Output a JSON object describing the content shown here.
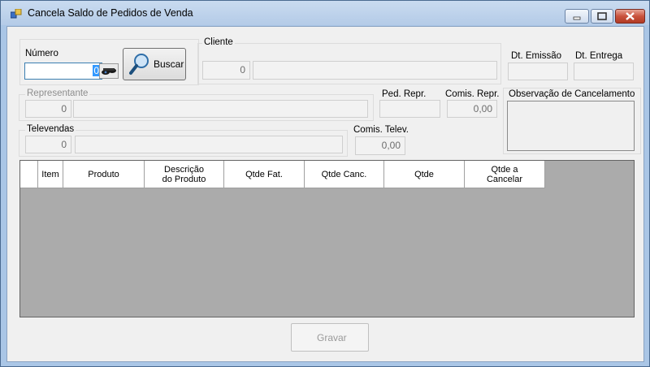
{
  "window": {
    "title": "Cancela Saldo de Pedidos de Venda"
  },
  "numero": {
    "label": "Número",
    "value": "0"
  },
  "buscar": {
    "label": "Buscar"
  },
  "cliente": {
    "label": "Cliente",
    "code": "0",
    "name": ""
  },
  "dates": {
    "emissao_label": "Dt. Emissão",
    "entrega_label": "Dt. Entrega",
    "emissao": "",
    "entrega": ""
  },
  "representante": {
    "label": "Representante",
    "code": "0",
    "name": ""
  },
  "ped_repr": {
    "label": "Ped. Repr.",
    "value": ""
  },
  "comis_repr": {
    "label": "Comis. Repr.",
    "value": "0,00"
  },
  "observacao": {
    "label": "Observação de Cancelamento",
    "value": ""
  },
  "televendas": {
    "label": "Televendas",
    "code": "0",
    "name": ""
  },
  "comis_telev": {
    "label": "Comis. Telev.",
    "value": "0,00"
  },
  "grid": {
    "columns": [
      "Item",
      "Produto",
      "Descrição do Produto",
      "Qtde Fat.",
      "Qtde Canc.",
      "Qtde",
      "Qtde a Cancelar"
    ]
  },
  "gravar": {
    "label": "Gravar"
  }
}
